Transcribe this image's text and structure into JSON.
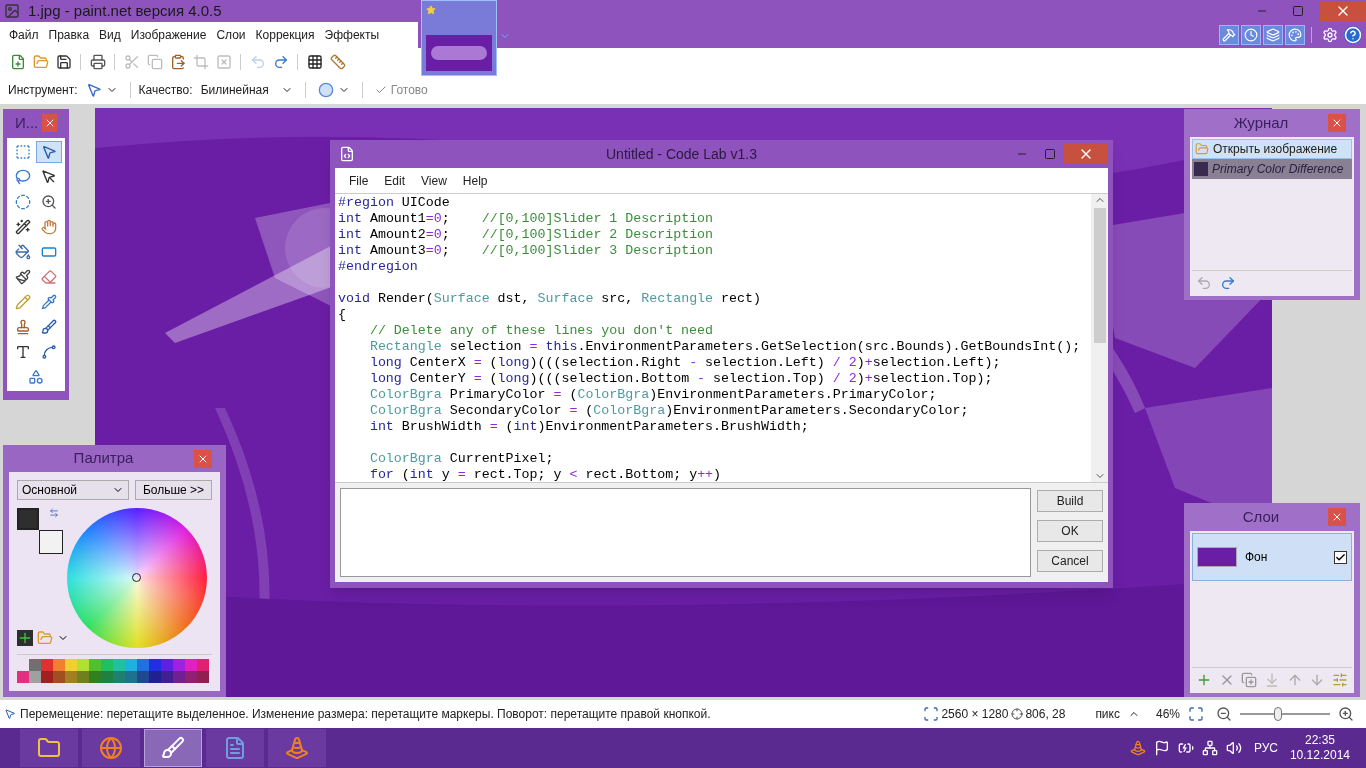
{
  "window": {
    "title": "1.jpg - paint.net версия 4.0.5"
  },
  "menu": [
    "Файл",
    "Правка",
    "Вид",
    "Изображение",
    "Слои",
    "Коррекция",
    "Эффекты"
  ],
  "toolbar": [
    [
      {
        "kind": "new",
        "disabled": false
      },
      {
        "kind": "open",
        "disabled": false
      },
      {
        "kind": "save",
        "disabled": false
      }
    ],
    [
      {
        "kind": "print",
        "disabled": false
      }
    ],
    [
      {
        "kind": "cut",
        "disabled": true
      },
      {
        "kind": "copy",
        "disabled": true
      },
      {
        "kind": "paste",
        "disabled": false
      },
      {
        "kind": "crop",
        "disabled": true
      },
      {
        "kind": "deselect",
        "disabled": true
      }
    ],
    [
      {
        "kind": "undo",
        "disabled": true
      },
      {
        "kind": "redo",
        "disabled": false
      }
    ],
    [
      {
        "kind": "grid",
        "disabled": false
      },
      {
        "kind": "rulers",
        "disabled": false
      }
    ]
  ],
  "tool_options": {
    "tool_label": "Инструмент:",
    "quality_label": "Качество:",
    "quality_value": "Билинейная",
    "done_label": "Готово",
    "done_disabled": true
  },
  "image_tabs": [
    {
      "selected": true
    }
  ],
  "panel_toggles": [
    {
      "kind": "tools",
      "on": true
    },
    {
      "kind": "history",
      "on": true
    },
    {
      "kind": "layers",
      "on": true
    },
    {
      "kind": "colors",
      "on": true
    }
  ],
  "tools_panel": {
    "title": "И...",
    "tools": [
      {
        "kind": "rect-select",
        "selected": false
      },
      {
        "kind": "move-selected",
        "selected": true
      },
      {
        "kind": "lasso",
        "selected": false
      },
      {
        "kind": "move-selection",
        "selected": false
      },
      {
        "kind": "ellipse-select",
        "selected": false
      },
      {
        "kind": "zoom",
        "selected": false
      },
      {
        "kind": "magic-wand",
        "selected": false
      },
      {
        "kind": "pan",
        "selected": false
      },
      {
        "kind": "bucket",
        "selected": false
      },
      {
        "kind": "gradient",
        "selected": false
      },
      {
        "kind": "brush",
        "selected": false
      },
      {
        "kind": "eraser",
        "selected": false
      },
      {
        "kind": "pencil",
        "selected": false
      },
      {
        "kind": "picker",
        "selected": false
      },
      {
        "kind": "stamp",
        "selected": false
      },
      {
        "kind": "recolor",
        "selected": false
      },
      {
        "kind": "text",
        "selected": false
      },
      {
        "kind": "line",
        "selected": false
      },
      {
        "kind": "shapes",
        "selected": false
      }
    ]
  },
  "palette_panel": {
    "title": "Палитра",
    "mode": "Основной",
    "more_button": "Больше >>",
    "current_colors": [
      {
        "color": "#2e2e2e"
      },
      {
        "color": "#f2f2f2"
      }
    ],
    "swatches_top": [
      {
        "color": "#707070"
      },
      {
        "color": "#e03030"
      },
      {
        "color": "#f08030"
      },
      {
        "color": "#f0d030"
      },
      {
        "color": "#b0e030"
      },
      {
        "color": "#50c030"
      },
      {
        "color": "#20c060"
      },
      {
        "color": "#20c0a0"
      },
      {
        "color": "#20b0e0"
      },
      {
        "color": "#2070e0"
      },
      {
        "color": "#2030e0"
      },
      {
        "color": "#6020e0"
      },
      {
        "color": "#a020e0"
      },
      {
        "color": "#e020c0"
      },
      {
        "color": "#e02070"
      }
    ],
    "swatches_bottom": [
      {
        "color": "#e0307f"
      },
      {
        "color": "#a0a0a0"
      },
      {
        "color": "#a02020"
      },
      {
        "color": "#a05020"
      },
      {
        "color": "#a08020"
      },
      {
        "color": "#708020"
      },
      {
        "color": "#308020"
      },
      {
        "color": "#208040"
      },
      {
        "color": "#208070"
      },
      {
        "color": "#207090"
      },
      {
        "color": "#204890"
      },
      {
        "color": "#202090"
      },
      {
        "color": "#402090"
      },
      {
        "color": "#702090"
      },
      {
        "color": "#902070"
      },
      {
        "color": "#902050"
      }
    ]
  },
  "history_panel": {
    "title": "Журнал",
    "items": [
      {
        "label": "Открыть изображение",
        "selected": true,
        "undone": false
      },
      {
        "label": "Primary Color Difference",
        "selected": false,
        "undone": true
      }
    ]
  },
  "layers_panel": {
    "title": "Слои",
    "layers": [
      {
        "name": "Фон",
        "selected": true,
        "visible": true
      }
    ]
  },
  "code_lab": {
    "title": "Untitled - Code Lab v1.3",
    "menu": [
      "File",
      "Edit",
      "View",
      "Help"
    ],
    "lines": [
      {
        "kind": "code",
        "indent": false,
        "segments": [
          {
            "kind": "kw",
            "text": "#region"
          },
          {
            "kind": "p",
            "text": " UICode"
          }
        ]
      },
      {
        "kind": "code",
        "indent": false,
        "segments": [
          {
            "kind": "kw",
            "text": "int"
          },
          {
            "kind": "p",
            "text": " Amount1"
          },
          {
            "kind": "op",
            "text": "=0"
          },
          {
            "kind": "p",
            "text": ";    "
          },
          {
            "kind": "cm",
            "text": "//[0,100]Slider 1 Description"
          }
        ]
      },
      {
        "kind": "code",
        "indent": false,
        "segments": [
          {
            "kind": "kw",
            "text": "int"
          },
          {
            "kind": "p",
            "text": " Amount2"
          },
          {
            "kind": "op",
            "text": "=0"
          },
          {
            "kind": "p",
            "text": ";    "
          },
          {
            "kind": "cm",
            "text": "//[0,100]Slider 2 Description"
          }
        ]
      },
      {
        "kind": "code",
        "indent": false,
        "segments": [
          {
            "kind": "kw",
            "text": "int"
          },
          {
            "kind": "p",
            "text": " Amount3"
          },
          {
            "kind": "op",
            "text": "=0"
          },
          {
            "kind": "p",
            "text": ";    "
          },
          {
            "kind": "cm",
            "text": "//[0,100]Slider 3 Description"
          }
        ]
      },
      {
        "kind": "code",
        "indent": false,
        "segments": [
          {
            "kind": "kw",
            "text": "#endregion"
          }
        ]
      },
      {
        "kind": "blank"
      },
      {
        "kind": "code",
        "indent": false,
        "segments": [
          {
            "kind": "kw",
            "text": "void"
          },
          {
            "kind": "p",
            "text": " Render("
          },
          {
            "kind": "ty",
            "text": "Surface"
          },
          {
            "kind": "p",
            "text": " dst, "
          },
          {
            "kind": "ty",
            "text": "Surface"
          },
          {
            "kind": "p",
            "text": " src, "
          },
          {
            "kind": "ty",
            "text": "Rectangle"
          },
          {
            "kind": "p",
            "text": " rect)"
          }
        ]
      },
      {
        "kind": "code",
        "indent": false,
        "segments": [
          {
            "kind": "p",
            "text": "{"
          }
        ]
      },
      {
        "kind": "code",
        "indent": true,
        "segments": [
          {
            "kind": "cm",
            "text": "// Delete any of these lines you don't need"
          }
        ]
      },
      {
        "kind": "code",
        "indent": true,
        "segments": [
          {
            "kind": "ty",
            "text": "Rectangle"
          },
          {
            "kind": "p",
            "text": " selection "
          },
          {
            "kind": "op",
            "text": "= "
          },
          {
            "kind": "kw",
            "text": "this"
          },
          {
            "kind": "p",
            "text": ".EnvironmentParameters.GetSelection(src.Bounds).GetBoundsInt();"
          }
        ]
      },
      {
        "kind": "code",
        "indent": true,
        "segments": [
          {
            "kind": "kw",
            "text": "long"
          },
          {
            "kind": "p",
            "text": " CenterX "
          },
          {
            "kind": "op",
            "text": "="
          },
          {
            "kind": "p",
            "text": " ("
          },
          {
            "kind": "kw",
            "text": "long"
          },
          {
            "kind": "p",
            "text": ")(((selection.Right "
          },
          {
            "kind": "op",
            "text": "-"
          },
          {
            "kind": "p",
            "text": " selection.Left) "
          },
          {
            "kind": "op",
            "text": "/ 2"
          },
          {
            "kind": "p",
            "text": ")"
          },
          {
            "kind": "op",
            "text": "+"
          },
          {
            "kind": "p",
            "text": "selection.Left);"
          }
        ]
      },
      {
        "kind": "code",
        "indent": true,
        "segments": [
          {
            "kind": "kw",
            "text": "long"
          },
          {
            "kind": "p",
            "text": " CenterY "
          },
          {
            "kind": "op",
            "text": "="
          },
          {
            "kind": "p",
            "text": " ("
          },
          {
            "kind": "kw",
            "text": "long"
          },
          {
            "kind": "p",
            "text": ")(((selection.Bottom "
          },
          {
            "kind": "op",
            "text": "-"
          },
          {
            "kind": "p",
            "text": " selection.Top) "
          },
          {
            "kind": "op",
            "text": "/ 2"
          },
          {
            "kind": "p",
            "text": ")"
          },
          {
            "kind": "op",
            "text": "+"
          },
          {
            "kind": "p",
            "text": "selection.Top);"
          }
        ]
      },
      {
        "kind": "code",
        "indent": true,
        "segments": [
          {
            "kind": "ty",
            "text": "ColorBgra"
          },
          {
            "kind": "p",
            "text": " PrimaryColor "
          },
          {
            "kind": "op",
            "text": "="
          },
          {
            "kind": "p",
            "text": " ("
          },
          {
            "kind": "ty",
            "text": "ColorBgra"
          },
          {
            "kind": "p",
            "text": ")EnvironmentParameters.PrimaryColor;"
          }
        ]
      },
      {
        "kind": "code",
        "indent": true,
        "segments": [
          {
            "kind": "ty",
            "text": "ColorBgra"
          },
          {
            "kind": "p",
            "text": " SecondaryColor "
          },
          {
            "kind": "op",
            "text": "="
          },
          {
            "kind": "p",
            "text": " ("
          },
          {
            "kind": "ty",
            "text": "ColorBgra"
          },
          {
            "kind": "p",
            "text": ")EnvironmentParameters.SecondaryColor;"
          }
        ]
      },
      {
        "kind": "code",
        "indent": true,
        "segments": [
          {
            "kind": "kw",
            "text": "int"
          },
          {
            "kind": "p",
            "text": " BrushWidth "
          },
          {
            "kind": "op",
            "text": "="
          },
          {
            "kind": "p",
            "text": " ("
          },
          {
            "kind": "kw",
            "text": "int"
          },
          {
            "kind": "p",
            "text": ")EnvironmentParameters.BrushWidth;"
          }
        ]
      },
      {
        "kind": "blank"
      },
      {
        "kind": "code",
        "indent": true,
        "segments": [
          {
            "kind": "ty",
            "text": "ColorBgra"
          },
          {
            "kind": "p",
            "text": " CurrentPixel;"
          }
        ]
      },
      {
        "kind": "code",
        "indent": true,
        "segments": [
          {
            "kind": "kw",
            "text": "for"
          },
          {
            "kind": "p",
            "text": " ("
          },
          {
            "kind": "kw",
            "text": "int"
          },
          {
            "kind": "p",
            "text": " y "
          },
          {
            "kind": "op",
            "text": "="
          },
          {
            "kind": "p",
            "text": " rect.Top; y "
          },
          {
            "kind": "op",
            "text": "<"
          },
          {
            "kind": "p",
            "text": " rect.Bottom; y"
          },
          {
            "kind": "op",
            "text": "++"
          },
          {
            "kind": "p",
            "text": ")"
          }
        ]
      }
    ],
    "buttons": [
      "Build",
      "OK",
      "Cancel"
    ]
  },
  "status_bar": {
    "hint": "Перемещение: перетащите выделенное. Изменение размера: перетащите маркеры. Поворот: перетащите правой кнопкой.",
    "image_size": "2560 × 1280",
    "cursor": "806, 28",
    "units": "пикс",
    "zoom": "46%",
    "zoom_slider": {
      "level": 0.42
    }
  },
  "taskbar": {
    "apps": [
      {
        "kind": "folder",
        "selected": false
      },
      {
        "kind": "browser",
        "selected": false
      },
      {
        "kind": "paint",
        "selected": true
      },
      {
        "kind": "document",
        "selected": false
      },
      {
        "kind": "cone",
        "selected": false
      }
    ],
    "language": "РУС",
    "time": "22:35",
    "date": "10.12.2014"
  }
}
